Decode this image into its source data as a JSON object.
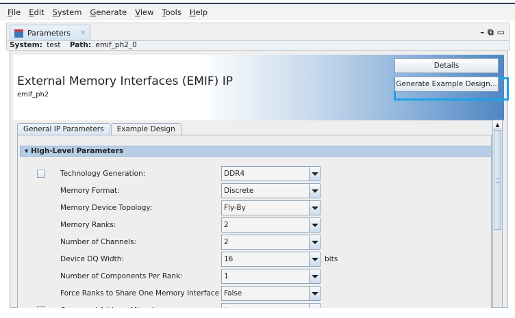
{
  "menu": [
    "File",
    "Edit",
    "System",
    "Generate",
    "View",
    "Tools",
    "Help"
  ],
  "tab": {
    "label": "Parameters"
  },
  "system_line": {
    "system_label": "System:",
    "system_value": "test",
    "path_label": "Path:",
    "path_value": "emif_ph2_0"
  },
  "header": {
    "title": "External Memory Interfaces (EMIF) IP",
    "subtitle": "emif_ph2",
    "details_button": "Details",
    "generate_button": "Generate Example Design..."
  },
  "tabs": [
    "General IP Parameters",
    "Example Design"
  ],
  "section": {
    "title": "High-Level Parameters"
  },
  "params": [
    {
      "label": "Technology Generation:",
      "value": "DDR4",
      "checkbox": "unchecked"
    },
    {
      "label": "Memory Format:",
      "value": "Discrete"
    },
    {
      "label": "Memory Device Topology:",
      "value": "Fly-By"
    },
    {
      "label": "Memory Ranks:",
      "value": "2"
    },
    {
      "label": "Number of Channels:",
      "value": "2"
    },
    {
      "label": "Device DQ Width:",
      "value": "16",
      "unit": "bits"
    },
    {
      "label": "Number of Components Per Rank:",
      "value": "1"
    },
    {
      "label": "Force Ranks to Share One Memory Interface Clock:",
      "value": "False"
    },
    {
      "label": "Command-Address Mirroring:",
      "value": "False",
      "checkbox": "checked",
      "disabled": true
    }
  ],
  "colors": {
    "highlight": "#1aa3e8",
    "section": "#b6cde6"
  }
}
